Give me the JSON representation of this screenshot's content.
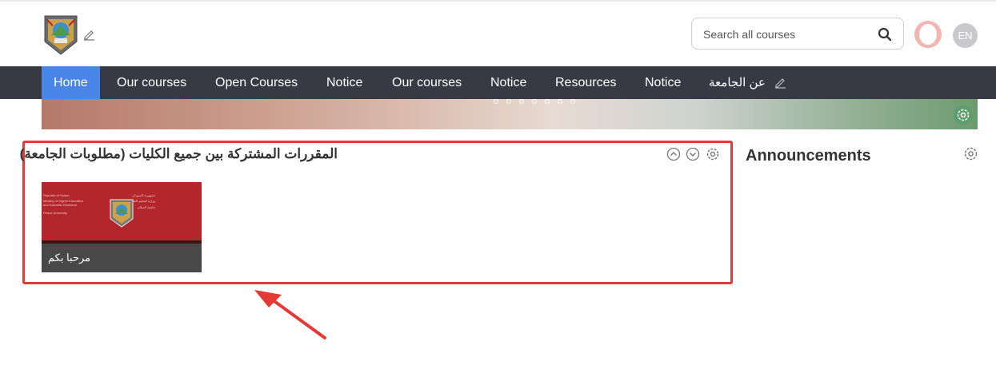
{
  "header": {
    "search_placeholder": "Search all courses",
    "language": "EN"
  },
  "nav": {
    "items": [
      {
        "label": "Home",
        "active": true
      },
      {
        "label": "Our courses"
      },
      {
        "label": "Open Courses"
      },
      {
        "label": "Notice"
      },
      {
        "label": "Our courses"
      },
      {
        "label": "Notice"
      },
      {
        "label": "Resources"
      },
      {
        "label": "Notice"
      },
      {
        "label": "عن الجامعة"
      }
    ]
  },
  "section": {
    "title": "المقررات المشتركة بين جميع الكليات (مطلوبات الجامعة)",
    "course": {
      "caption": "مرحبا بكم",
      "image_text_left": [
        "Republic of Sudan",
        "Ministry of Higher Education",
        "and Scientific Research",
        "Peace University"
      ],
      "image_text_right": [
        "جمهورية السودان",
        "وزارة التعليم العالي والبحث العلمي",
        "جامعة السلام"
      ]
    }
  },
  "sidebar": {
    "announcements_title": "Announcements"
  },
  "colors": {
    "nav_bg": "#373a45",
    "nav_active": "#4a86e8",
    "highlight_red": "#e53935",
    "course_red": "#b3262b"
  }
}
